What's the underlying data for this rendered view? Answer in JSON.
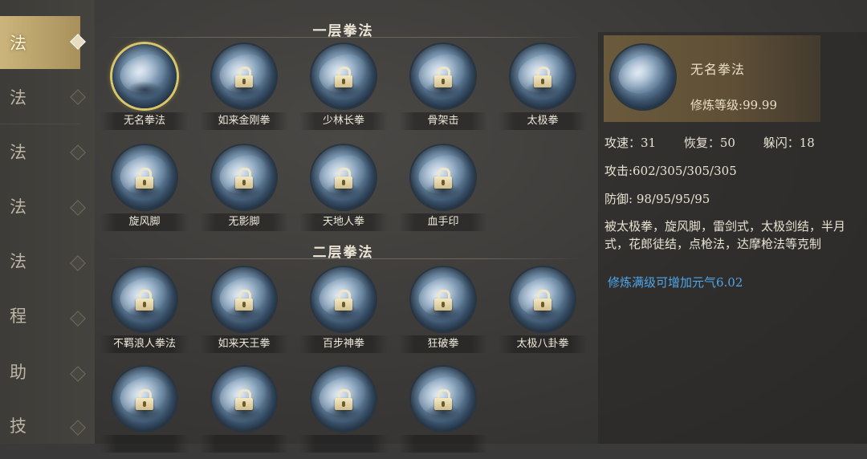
{
  "sidebar": {
    "items": [
      {
        "label": "法",
        "active": true
      },
      {
        "label": "法",
        "active": false
      },
      {
        "label": "法",
        "active": false
      },
      {
        "label": "法",
        "active": false
      },
      {
        "label": "法",
        "active": false
      },
      {
        "label": "程",
        "active": false
      },
      {
        "label": "助",
        "active": false
      },
      {
        "label": "技",
        "active": false
      }
    ]
  },
  "sections": [
    {
      "title": "一层拳法",
      "skills": [
        {
          "name": "无名拳法",
          "locked": false,
          "selected": true,
          "icon": "fist-icon"
        },
        {
          "name": "如来金刚拳",
          "locked": true,
          "icon": "palm-icon"
        },
        {
          "name": "少林长拳",
          "locked": true,
          "icon": "fist-icon"
        },
        {
          "name": "骨架击",
          "locked": true,
          "icon": "fist-icon"
        },
        {
          "name": "太极拳",
          "locked": true,
          "icon": "fist-icon"
        },
        {
          "name": "旋风脚",
          "locked": true,
          "icon": "kick-icon"
        },
        {
          "name": "无影脚",
          "locked": true,
          "icon": "kick-icon"
        },
        {
          "name": "天地人拳",
          "locked": true,
          "icon": "fist-icon"
        },
        {
          "name": "血手印",
          "locked": true,
          "icon": "palm-icon"
        }
      ]
    },
    {
      "title": "二层拳法",
      "skills": [
        {
          "name": "不羁浪人拳法",
          "locked": true,
          "icon": "fist-icon"
        },
        {
          "name": "如来天王拳",
          "locked": true,
          "icon": "palm-icon"
        },
        {
          "name": "百步神拳",
          "locked": true,
          "icon": "fist-icon"
        },
        {
          "name": "狂破拳",
          "locked": true,
          "icon": "fist-icon"
        },
        {
          "name": "太极八卦拳",
          "locked": true,
          "icon": "fist-icon"
        },
        {
          "name": "",
          "locked": true,
          "icon": "fist-icon"
        },
        {
          "name": "",
          "locked": true,
          "icon": "fist-icon"
        },
        {
          "name": "",
          "locked": true,
          "icon": "fist-icon"
        },
        {
          "name": "",
          "locked": true,
          "icon": "fist-icon"
        }
      ]
    }
  ],
  "detail": {
    "title": "无名拳法",
    "level_label": "修炼等级:",
    "level_value": "99.99",
    "speed": "攻速：31",
    "recover": "恢复：50",
    "dodge": "躲闪：18",
    "attack": "攻击:602/305/305/305",
    "defense": "防御: 98/95/95/95",
    "description": "被太极拳，旋风脚，雷剑式，太极剑结，半月式，花郎徒结，点枪法，达摩枪法等克制",
    "bonus": "修炼满级可增加元气6.02"
  },
  "colors": {
    "accent_gold": "#cbb57c",
    "bonus_blue": "#4fa6e8",
    "selected_ring": "#d9c66a"
  }
}
